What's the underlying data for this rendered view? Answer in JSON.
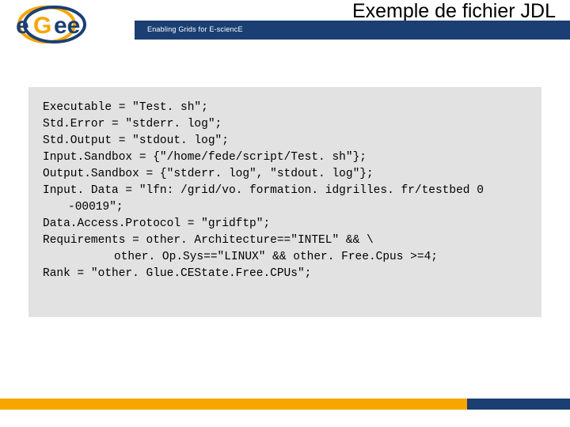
{
  "header": {
    "title": "Exemple de fichier JDL",
    "tagline": "Enabling Grids for E-sciencE",
    "logo_text_e": "e",
    "logo_text_g": "G",
    "logo_text_ee": "ee"
  },
  "code": {
    "lines": [
      "Executable = \"Test. sh\";",
      "Std.Error = \"stderr. log\";",
      "Std.Output = \"stdout. log\";",
      "Input.Sandbox = {\"/home/fede/script/Test. sh\"};",
      "Output.Sandbox = {\"stderr. log\", \"stdout. log\"};",
      "Input. Data = \"lfn: /grid/vo. formation. idgrilles. fr/testbed 0 -00019\";",
      "Data.Access.Protocol = \"gridftp\";",
      "Requirements = other. Architecture==\"INTEL\" && \\",
      "other. Op.Sys==\"LINUX\" && other. Free.Cpus >=4;",
      "Rank = \"other. Glue.CEState.Free.CPUs\";"
    ]
  },
  "colors": {
    "brand_blue": "#1b3f73",
    "brand_orange": "#f7a600",
    "code_bg": "#e2e2e2"
  }
}
